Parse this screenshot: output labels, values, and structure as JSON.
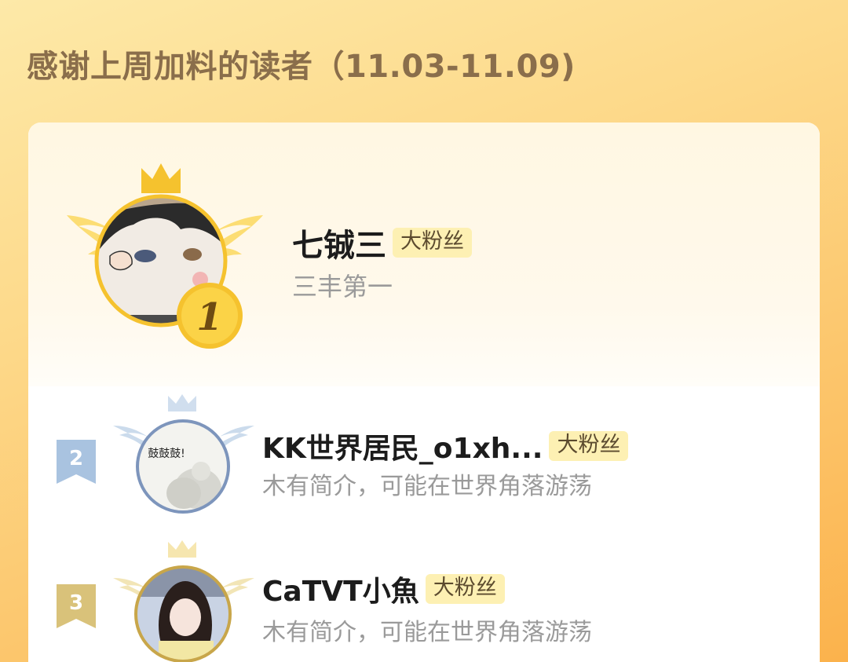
{
  "header": {
    "title": "感谢上周加料的读者（11.03-11.09)"
  },
  "readers": [
    {
      "rank": "1",
      "name": "七铖三",
      "badge": "大粉丝",
      "bio": "三丰第一"
    },
    {
      "rank": "2",
      "name": "KK世界居民_o1xh...",
      "badge": "大粉丝",
      "bio": "木有简介，可能在世界角落游荡",
      "avatar_text": "鼓鼓鼓!"
    },
    {
      "rank": "3",
      "name": "CaTVT小魚",
      "badge": "大粉丝",
      "bio": "木有简介，可能在世界角落游荡"
    }
  ],
  "colors": {
    "gold": "#f5c22e",
    "silver": "#a9c3e0",
    "bronze": "#d9c27a",
    "badge_bg": "#fdf0b3",
    "title": "#8a6e4b"
  }
}
